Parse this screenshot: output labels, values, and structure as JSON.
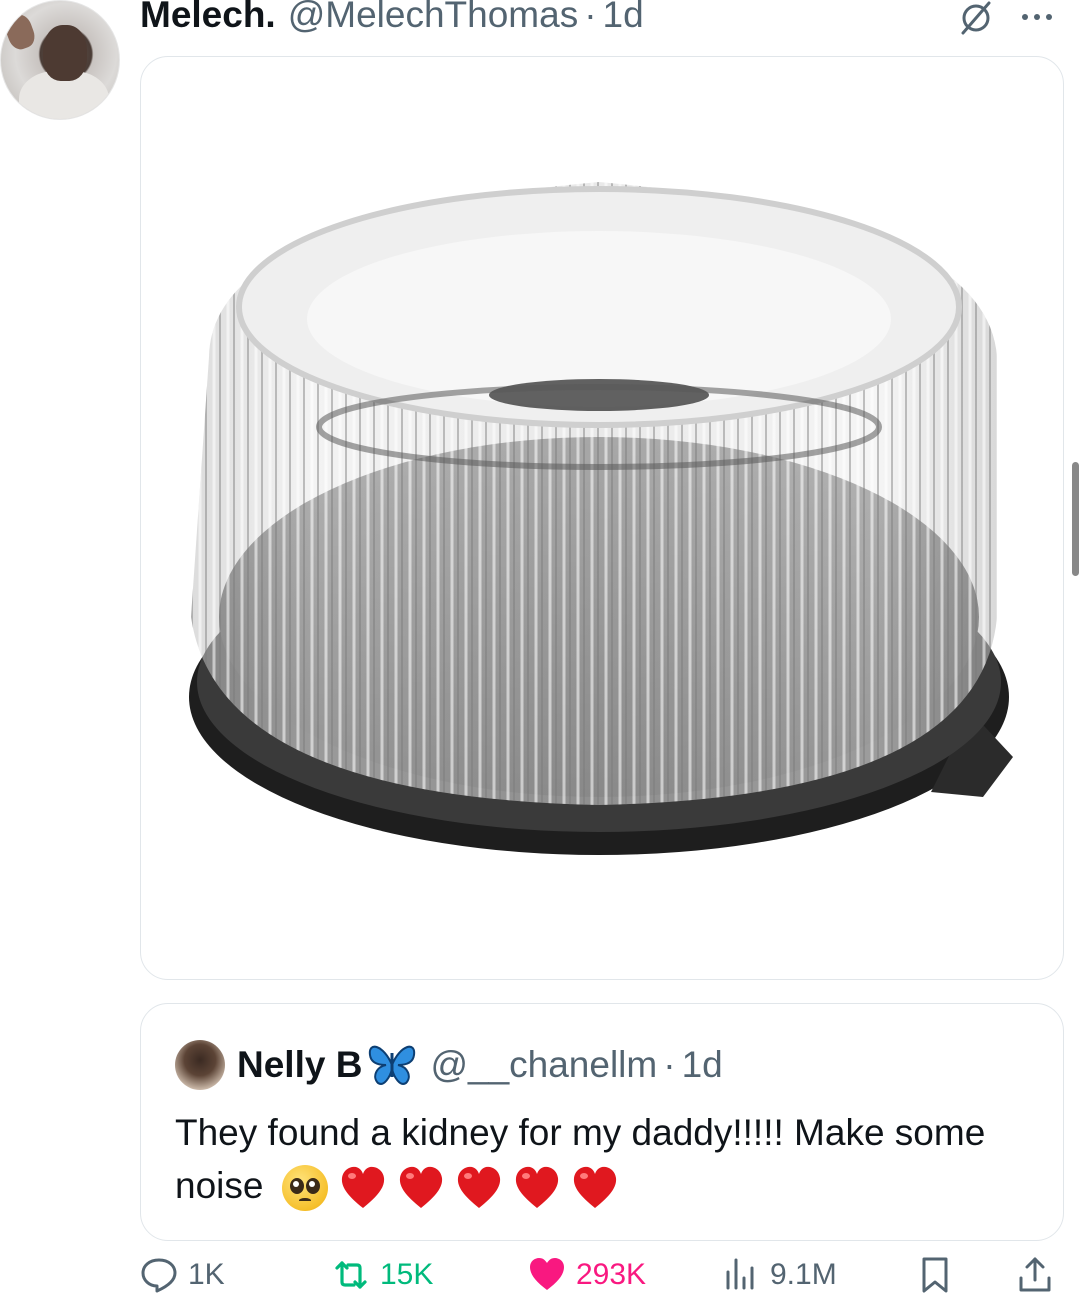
{
  "author": {
    "name": "Melech.",
    "handle": "@MelechThomas",
    "separator": "·",
    "time": "1d"
  },
  "header_icons": [
    "grok-icon",
    "more-icon"
  ],
  "media": {
    "description_icon": "cake-container-image"
  },
  "quoted_post": {
    "name": "Nelly B",
    "badge_icon": "butterfly-emoji-icon",
    "handle": "@__chanellm",
    "separator": "·",
    "time": "1d",
    "text": "They found a kidney for my daddy!!!!! Make some noise",
    "emojis": [
      "pleading-face",
      "red-heart",
      "red-heart",
      "red-heart",
      "red-heart",
      "red-heart"
    ]
  },
  "actions": {
    "replies": "1K",
    "reposts": "15K",
    "likes": "293K",
    "views": "9.1M"
  },
  "colors": {
    "repost": "#00ba7c",
    "like": "#f91880",
    "muted": "#536471",
    "heart_emoji": "#e0181f"
  }
}
